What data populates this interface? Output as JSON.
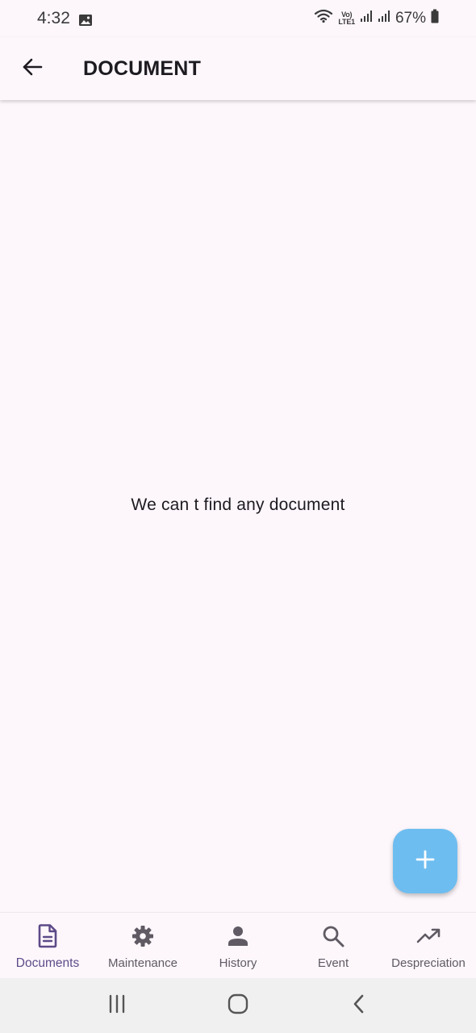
{
  "status_bar": {
    "time": "4:32",
    "volte_top": "Vo)",
    "volte_bottom": "LTE1",
    "battery": "67%"
  },
  "app_bar": {
    "title": "DOCUMENT",
    "back_icon": "arrow-back-icon"
  },
  "content": {
    "empty_message": "We can t find any document"
  },
  "fab": {
    "icon": "plus-icon",
    "color": "#6ebdf0"
  },
  "bottom_nav": {
    "active_color": "#5d4a88",
    "items": [
      {
        "label": "Documents",
        "icon": "document-icon",
        "active": true
      },
      {
        "label": "Maintenance",
        "icon": "gear-icon",
        "active": false
      },
      {
        "label": "History",
        "icon": "person-icon",
        "active": false
      },
      {
        "label": "Event",
        "icon": "search-icon",
        "active": false
      },
      {
        "label": "Despreciation",
        "icon": "trending-up-icon",
        "active": false
      }
    ]
  },
  "system_nav": {
    "buttons": [
      "recent-apps-icon",
      "home-icon",
      "back-chevron-icon"
    ]
  }
}
